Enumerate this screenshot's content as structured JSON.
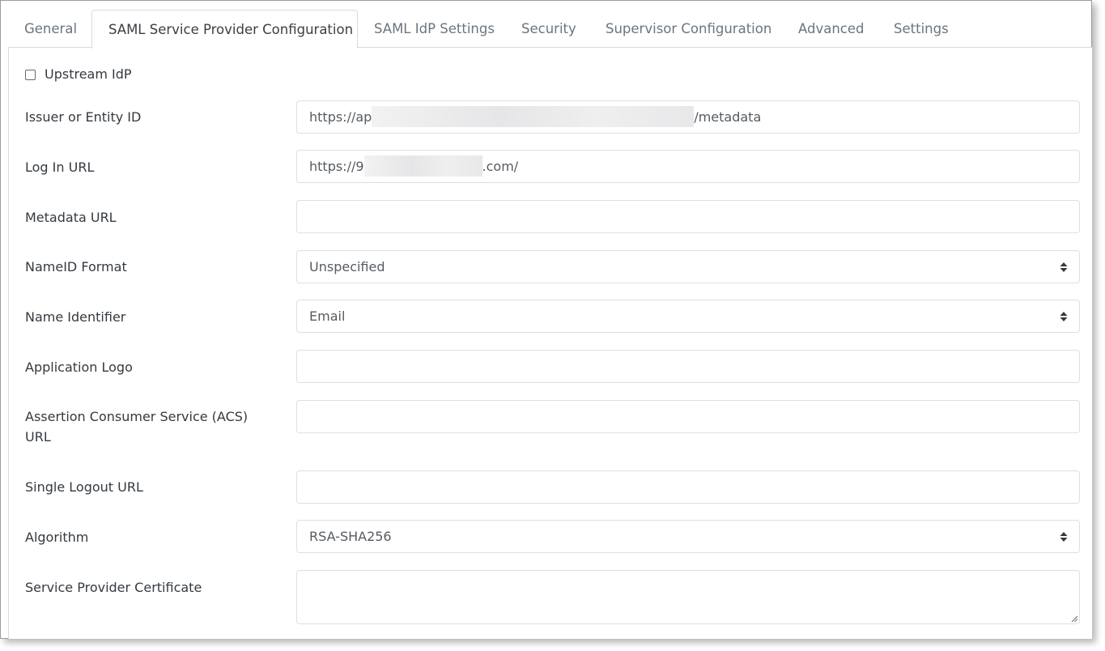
{
  "tabs": [
    {
      "label": "General",
      "active": false
    },
    {
      "label": "SAML Service Provider Configuration",
      "active": true
    },
    {
      "label": "SAML IdP Settings",
      "active": false
    },
    {
      "label": "Security",
      "active": false
    },
    {
      "label": "Supervisor Configuration",
      "active": false
    },
    {
      "label": "Advanced",
      "active": false
    },
    {
      "label": "Settings",
      "active": false
    }
  ],
  "form": {
    "upstream_idp": {
      "label": "Upstream IdP",
      "checked": false
    },
    "issuer": {
      "label": "Issuer or Entity ID",
      "value_prefix": "https://ap",
      "value_suffix": "/metadata",
      "redacted": true
    },
    "login_url": {
      "label": "Log In URL",
      "value_prefix": "https://9",
      "value_suffix": ".com/",
      "redacted": true
    },
    "metadata_url": {
      "label": "Metadata URL",
      "value": ""
    },
    "nameid_format": {
      "label": "NameID Format",
      "value": "Unspecified"
    },
    "name_identifier": {
      "label": "Name Identifier",
      "value": "Email"
    },
    "application_logo": {
      "label": "Application Logo",
      "value": ""
    },
    "acs_url": {
      "label_line1": "Assertion Consumer Service (ACS)",
      "label_line2": "URL",
      "value": ""
    },
    "single_logout_url": {
      "label": "Single Logout URL",
      "value": ""
    },
    "algorithm": {
      "label": "Algorithm",
      "value": "RSA-SHA256"
    },
    "sp_certificate": {
      "label": "Service Provider Certificate",
      "value": ""
    }
  },
  "icons": {
    "select_arrows": "up-down-caret-icon",
    "resize_handle": "resize-grip-icon"
  }
}
